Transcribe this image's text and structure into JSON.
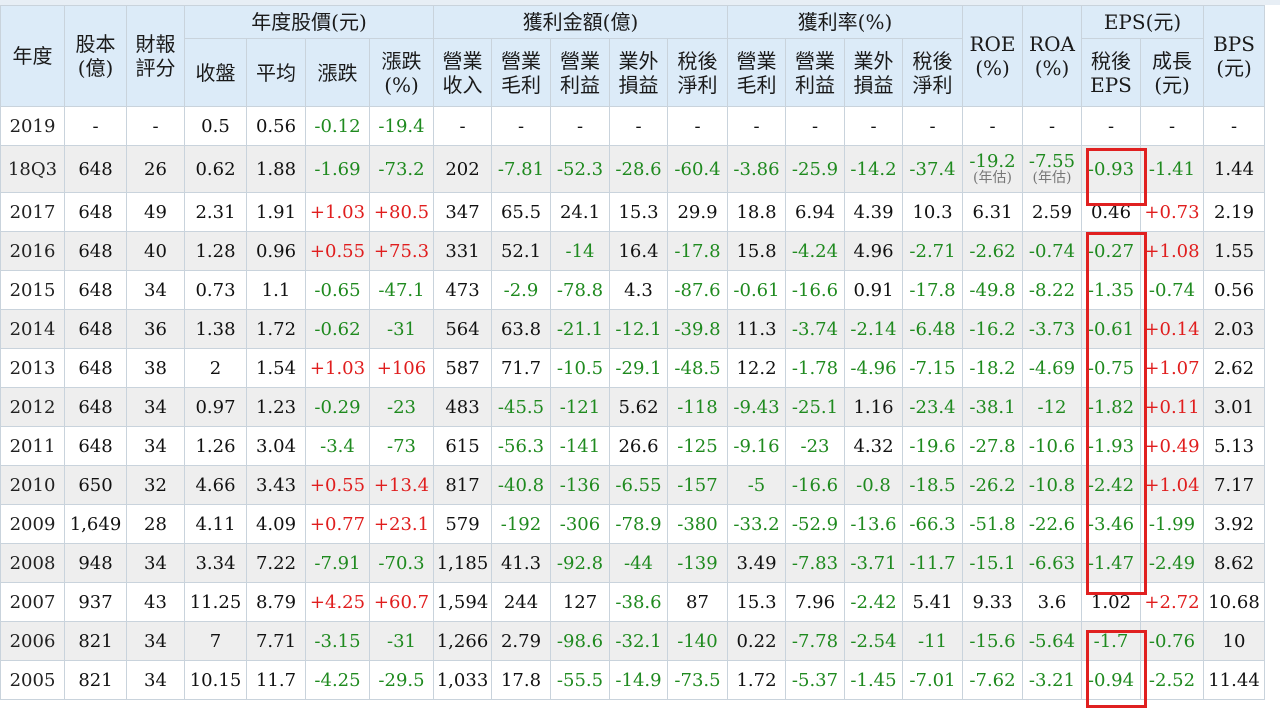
{
  "headers": {
    "year": "年度",
    "capital": "股本\n(億)",
    "rating": "財報\n評分",
    "price_group": "年度股價(元)",
    "profit_amount_group": "獲利金額(億)",
    "profit_rate_group": "獲利率(%)",
    "roe": "ROE\n(%)",
    "roa": "ROA\n(%)",
    "eps_group": "EPS(元)",
    "bps": "BPS\n(元)",
    "close": "收盤",
    "avg": "平均",
    "change": "漲跌",
    "change_pct": "漲跌\n(%)",
    "revenue": "營業\n收入",
    "gross_profit": "營業\n毛利",
    "op_profit": "營業\n利益",
    "non_op": "業外\n損益",
    "net_profit": "稅後\n淨利",
    "gross_margin": "營業\n毛利",
    "op_margin": "營業\n利益",
    "non_op_rate": "業外\n損益",
    "net_margin": "稅後\n淨利",
    "eps_after_tax": "稅後\nEPS",
    "eps_growth": "成長\n(元)"
  },
  "note_annualized": "(年估)",
  "rows": [
    [
      "2019",
      "-",
      "-",
      "0.5",
      "0.56",
      "-0.12",
      "-19.4",
      "-",
      "-",
      "-",
      "-",
      "-",
      "-",
      "-",
      "-",
      "-",
      "-",
      "-",
      "-",
      "-",
      "-"
    ],
    [
      "18Q3",
      "648",
      "26",
      "0.62",
      "1.88",
      "-1.69",
      "-73.2",
      "202",
      "-7.81",
      "-52.3",
      "-28.6",
      "-60.4",
      "-3.86",
      "-25.9",
      "-14.2",
      "-37.4",
      "-19.2",
      "-7.55",
      "-0.93",
      "-1.41",
      "1.44"
    ],
    [
      "2017",
      "648",
      "49",
      "2.31",
      "1.91",
      "+1.03",
      "+80.5",
      "347",
      "65.5",
      "24.1",
      "15.3",
      "29.9",
      "18.8",
      "6.94",
      "4.39",
      "10.3",
      "6.31",
      "2.59",
      "0.46",
      "+0.73",
      "2.19"
    ],
    [
      "2016",
      "648",
      "40",
      "1.28",
      "0.96",
      "+0.55",
      "+75.3",
      "331",
      "52.1",
      "-14",
      "16.4",
      "-17.8",
      "15.8",
      "-4.24",
      "4.96",
      "-2.71",
      "-2.62",
      "-0.74",
      "-0.27",
      "+1.08",
      "1.55"
    ],
    [
      "2015",
      "648",
      "34",
      "0.73",
      "1.1",
      "-0.65",
      "-47.1",
      "473",
      "-2.9",
      "-78.8",
      "4.3",
      "-87.6",
      "-0.61",
      "-16.6",
      "0.91",
      "-17.8",
      "-49.8",
      "-8.22",
      "-1.35",
      "-0.74",
      "0.56"
    ],
    [
      "2014",
      "648",
      "36",
      "1.38",
      "1.72",
      "-0.62",
      "-31",
      "564",
      "63.8",
      "-21.1",
      "-12.1",
      "-39.8",
      "11.3",
      "-3.74",
      "-2.14",
      "-6.48",
      "-16.2",
      "-3.73",
      "-0.61",
      "+0.14",
      "2.03"
    ],
    [
      "2013",
      "648",
      "38",
      "2",
      "1.54",
      "+1.03",
      "+106",
      "587",
      "71.7",
      "-10.5",
      "-29.1",
      "-48.5",
      "12.2",
      "-1.78",
      "-4.96",
      "-7.15",
      "-18.2",
      "-4.69",
      "-0.75",
      "+1.07",
      "2.62"
    ],
    [
      "2012",
      "648",
      "34",
      "0.97",
      "1.23",
      "-0.29",
      "-23",
      "483",
      "-45.5",
      "-121",
      "5.62",
      "-118",
      "-9.43",
      "-25.1",
      "1.16",
      "-23.4",
      "-38.1",
      "-12",
      "-1.82",
      "+0.11",
      "3.01"
    ],
    [
      "2011",
      "648",
      "34",
      "1.26",
      "3.04",
      "-3.4",
      "-73",
      "615",
      "-56.3",
      "-141",
      "26.6",
      "-125",
      "-9.16",
      "-23",
      "4.32",
      "-19.6",
      "-27.8",
      "-10.6",
      "-1.93",
      "+0.49",
      "5.13"
    ],
    [
      "2010",
      "650",
      "32",
      "4.66",
      "3.43",
      "+0.55",
      "+13.4",
      "817",
      "-40.8",
      "-136",
      "-6.55",
      "-157",
      "-5",
      "-16.6",
      "-0.8",
      "-18.5",
      "-26.2",
      "-10.8",
      "-2.42",
      "+1.04",
      "7.17"
    ],
    [
      "2009",
      "1,649",
      "28",
      "4.11",
      "4.09",
      "+0.77",
      "+23.1",
      "579",
      "-192",
      "-306",
      "-78.9",
      "-380",
      "-33.2",
      "-52.9",
      "-13.6",
      "-66.3",
      "-51.8",
      "-22.6",
      "-3.46",
      "-1.99",
      "3.92"
    ],
    [
      "2008",
      "948",
      "34",
      "3.34",
      "7.22",
      "-7.91",
      "-70.3",
      "1,185",
      "41.3",
      "-92.8",
      "-44",
      "-139",
      "3.49",
      "-7.83",
      "-3.71",
      "-11.7",
      "-15.1",
      "-6.63",
      "-1.47",
      "-2.49",
      "8.62"
    ],
    [
      "2007",
      "937",
      "43",
      "11.25",
      "8.79",
      "+4.25",
      "+60.7",
      "1,594",
      "244",
      "127",
      "-38.6",
      "87",
      "15.3",
      "7.96",
      "-2.42",
      "5.41",
      "9.33",
      "3.6",
      "1.02",
      "+2.72",
      "10.68"
    ],
    [
      "2006",
      "821",
      "34",
      "7",
      "7.71",
      "-3.15",
      "-31",
      "1,266",
      "2.79",
      "-98.6",
      "-32.1",
      "-140",
      "0.22",
      "-7.78",
      "-2.54",
      "-11",
      "-15.6",
      "-5.64",
      "-1.7",
      "-0.76",
      "10"
    ],
    [
      "2005",
      "821",
      "34",
      "10.15",
      "11.7",
      "-4.25",
      "-29.5",
      "1,033",
      "17.8",
      "-55.5",
      "-14.9",
      "-73.5",
      "1.72",
      "-5.37",
      "-1.45",
      "-7.01",
      "-7.62",
      "-3.21",
      "-0.94",
      "-2.52",
      "11.44"
    ]
  ],
  "colors": {
    "header_bg": "#dcebf8",
    "negative": "#1f8a1f",
    "positive": "#e01e1e",
    "highlight_box": "#e02020",
    "row_alt": "#eeeeee"
  }
}
